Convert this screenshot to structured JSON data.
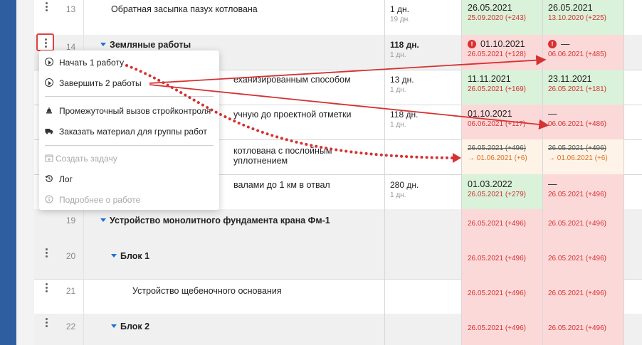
{
  "rows": [
    {
      "num": "13",
      "name": "Обратная засыпка пазух котлована",
      "dur": "1 дн.",
      "dur_sub": "19 дн.",
      "d1": "26.05.2021",
      "d1_sub": "25.09.2020 (+243)",
      "d2": "26.05.2021",
      "d2_sub": "13.10.2020 (+225)"
    },
    {
      "num": "14",
      "name": "Земляные работы",
      "dur": "118 дн.",
      "dur_sub": "1 дн.",
      "d1": "01.10.2021",
      "d1_sub": "26.05.2021 (+128)",
      "d2": "—",
      "d2_sub": "06.06.2021 (+485)"
    },
    {
      "name": "еханизированным способом",
      "dur": "13 дн.",
      "dur_sub": "1 дн.",
      "d1": "11.11.2021",
      "d1_sub": "26.05.2021 (+169)",
      "d2": "23.11.2021",
      "d2_sub": "26.05.2021 (+181)"
    },
    {
      "name": "учную до проектной отметки",
      "dur": "118 дн.",
      "dur_sub": "1 дн.",
      "d1": "01.10.2021",
      "d1_sub": "06.06.2021 (+117)",
      "d2": "—",
      "d2_sub": "06.06.2021 (+486)"
    },
    {
      "name": "котлована с послойным уплотнением",
      "d1_old": "26.05.2021 (+496)",
      "d1_new": "→ 01.06.2021 (+6)",
      "d2_old": "26.05.2021 (+496)",
      "d2_new": "→ 01.06.2021 (+6)"
    },
    {
      "name": "валами до 1 км в отвал",
      "dur": "280 дн.",
      "dur_sub": "1 дн.",
      "d1": "01.03.2022",
      "d1_sub": "26.05.2021 (+279)",
      "d2": "—",
      "d2_sub": "26.05.2021 (+496)"
    },
    {
      "num": "19",
      "name": "Устройство монолитного фундамента крана Фм-1",
      "d1_sub": "26.05.2021 (+496)",
      "d2_sub": "26.05.2021 (+496)"
    },
    {
      "num": "20",
      "name": "Блок 1",
      "d1_sub": "26.05.2021 (+496)",
      "d2_sub": "26.05.2021 (+496)"
    },
    {
      "num": "21",
      "name": "Устройство щебеночного основания",
      "d1_sub": "26.05.2021 (+496)",
      "d2_sub": "26.05.2021 (+496)"
    },
    {
      "num": "22",
      "name": "Блок 2",
      "d1_sub": "26.05.2021 (+496)",
      "d2_sub": "26.05.2021 (+496)"
    }
  ],
  "menu": {
    "start": "Начать 1 работу",
    "finish": "Завершить 2 работы",
    "inspection": "Промежуточный вызов стройконтроля",
    "order": "Заказать материал для группы работ",
    "create_task": "Создать задачу",
    "log": "Лог",
    "details": "Подробнее о работе"
  },
  "colors": {
    "accent": "#e04040",
    "caret": "#1e6fd9",
    "green_cell": "#d9f2d9",
    "red_cell": "#fcd9d9",
    "orange_cell": "#fdf3e6",
    "sidebar": "#2e5e9e"
  }
}
